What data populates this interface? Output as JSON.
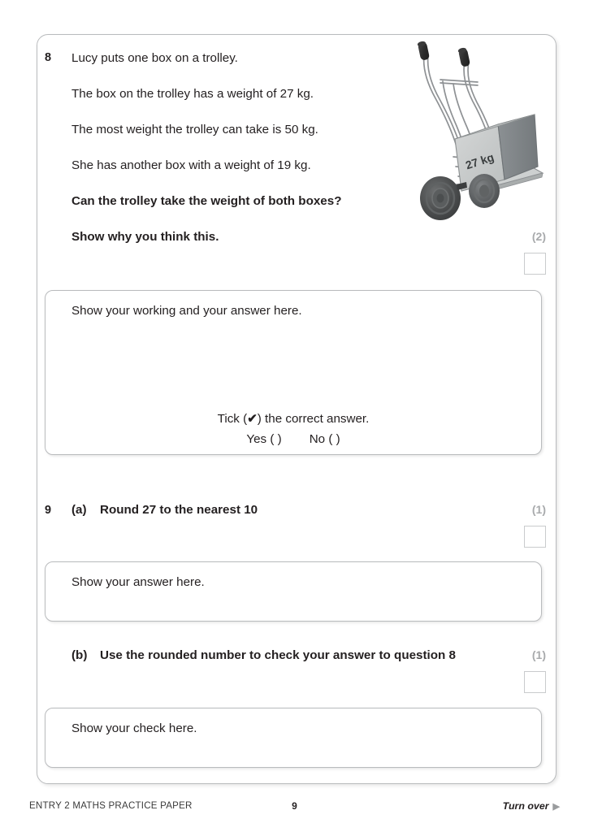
{
  "document": {
    "title": "ENTRY 2 MATHS PRACTICE PAPER",
    "page_number": "9",
    "turn_over": "Turn over",
    "turn_over_arrow": "▶"
  },
  "colors": {
    "text": "#231f20",
    "frame_border": "#b9bbbd",
    "marks_grey": "#a8aaac",
    "mark_box_border": "#c9cbcd",
    "box_front": "#c9cbcb",
    "box_side": "#7e8386",
    "wheel_dark": "#4a4a4a",
    "frame_metal": "#8e9194"
  },
  "questions": [
    {
      "number": "8",
      "lines": [
        {
          "text": "Lucy puts one box on a trolley.",
          "bold": false
        },
        {
          "text": "The box on the trolley has a weight of 27 kg.",
          "bold": false
        },
        {
          "text": "The most weight the trolley can take is 50 kg.",
          "bold": false
        },
        {
          "text": "She has another box with a weight of 19 kg.",
          "bold": false
        },
        {
          "text": "Can the trolley take the weight of both boxes?",
          "bold": true
        },
        {
          "text": "Show why you think this.",
          "bold": true
        }
      ],
      "marks": "(2)",
      "answer_box": {
        "label": "Show your working and your answer here.",
        "tick_prefix": "Tick (",
        "tick_glyph": "✔",
        "tick_suffix": ") the correct answer.",
        "option_yes": "Yes (    )",
        "option_no": "No (    )"
      }
    },
    {
      "number": "9",
      "parts": [
        {
          "label": "(a)",
          "text": "Round 27 to the nearest 10",
          "marks": "(1)",
          "answer_box": {
            "label": "Show your answer here."
          }
        },
        {
          "label": "(b)",
          "text": "Use the rounded number to check your answer to question 8",
          "marks": "(1)",
          "answer_box": {
            "label": "Show your check here."
          }
        }
      ]
    }
  ],
  "illustration": {
    "name": "hand-trolley-with-box",
    "box_label": "27 kg"
  }
}
